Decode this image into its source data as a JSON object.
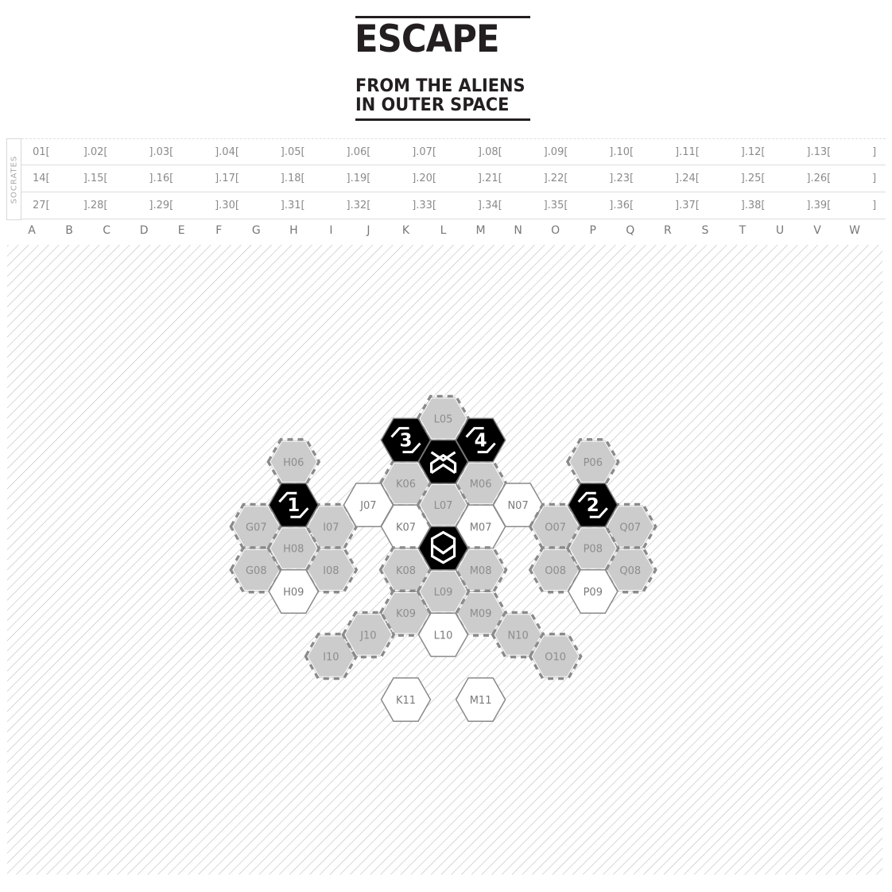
{
  "title": {
    "main": "ESCAPE",
    "line2": "FROM THE ALIENS",
    "line3": "IN OUTER SPACE"
  },
  "log": {
    "sector_label": "SOCRATES",
    "rows": [
      [
        "01[",
        "].02[",
        "].03[",
        "].04[",
        "].05[",
        "].06[",
        "].07[",
        "].08[",
        "].09[",
        "].10[",
        "].11[",
        "].12[",
        "].13[",
        "]"
      ],
      [
        "14[",
        "].15[",
        "].16[",
        "].17[",
        "].18[",
        "].19[",
        "].20[",
        "].21[",
        "].22[",
        "].23[",
        "].24[",
        "].25[",
        "].26[",
        "]"
      ],
      [
        "27[",
        "].28[",
        "].29[",
        "].30[",
        "].31[",
        "].32[",
        "].33[",
        "].34[",
        "].35[",
        "].36[",
        "].37[",
        "].38[",
        "].39[",
        "]"
      ]
    ]
  },
  "columns": [
    "A",
    "B",
    "C",
    "D",
    "E",
    "F",
    "G",
    "H",
    "I",
    "J",
    "K",
    "L",
    "M",
    "N",
    "O",
    "P",
    "Q",
    "R",
    "S",
    "T",
    "U",
    "V",
    "W"
  ],
  "colors": {
    "dangerous": "#cccccc",
    "secure": "#ffffff",
    "special": "#000000",
    "border": "#8a8a8a",
    "hatch": "#b8b8b8"
  },
  "board": {
    "sectors": [
      {
        "id": "L05",
        "type": "dangerous"
      },
      {
        "id": "K06",
        "type": "dangerous"
      },
      {
        "id": "M06",
        "type": "dangerous"
      },
      {
        "id": "H06",
        "type": "dangerous"
      },
      {
        "id": "P06",
        "type": "dangerous"
      },
      {
        "id": "G07",
        "type": "dangerous"
      },
      {
        "id": "I07",
        "type": "dangerous"
      },
      {
        "id": "J07",
        "type": "secure"
      },
      {
        "id": "K07",
        "type": "secure"
      },
      {
        "id": "L07",
        "type": "dangerous"
      },
      {
        "id": "M07",
        "type": "secure"
      },
      {
        "id": "N07",
        "type": "secure"
      },
      {
        "id": "O07",
        "type": "dangerous"
      },
      {
        "id": "Q07",
        "type": "dangerous"
      },
      {
        "id": "G08",
        "type": "dangerous"
      },
      {
        "id": "I08",
        "type": "dangerous"
      },
      {
        "id": "K08",
        "type": "dangerous"
      },
      {
        "id": "M08",
        "type": "dangerous"
      },
      {
        "id": "O08",
        "type": "dangerous"
      },
      {
        "id": "Q08",
        "type": "dangerous"
      },
      {
        "id": "H08",
        "type": "dangerous"
      },
      {
        "id": "P08",
        "type": "dangerous"
      },
      {
        "id": "K09",
        "type": "dangerous"
      },
      {
        "id": "M09",
        "type": "dangerous"
      },
      {
        "id": "L09",
        "type": "dangerous"
      },
      {
        "id": "H09",
        "type": "secure"
      },
      {
        "id": "P09",
        "type": "secure"
      },
      {
        "id": "I10",
        "type": "dangerous"
      },
      {
        "id": "J10",
        "type": "dangerous"
      },
      {
        "id": "L10",
        "type": "secure"
      },
      {
        "id": "N10",
        "type": "dangerous"
      },
      {
        "id": "O10",
        "type": "dangerous"
      },
      {
        "id": "K11",
        "type": "secure"
      },
      {
        "id": "M11",
        "type": "secure"
      }
    ],
    "special_sectors": [
      {
        "id": "K05",
        "kind": "escape-hatch",
        "number": "3"
      },
      {
        "id": "M05",
        "kind": "escape-hatch",
        "number": "4"
      },
      {
        "id": "H07",
        "kind": "escape-hatch",
        "number": "1"
      },
      {
        "id": "P07",
        "kind": "escape-hatch",
        "number": "2"
      },
      {
        "id": "L06",
        "kind": "alien-sector",
        "icon": "alien-start-icon"
      },
      {
        "id": "L08",
        "kind": "human-sector",
        "icon": "human-start-icon"
      }
    ]
  }
}
